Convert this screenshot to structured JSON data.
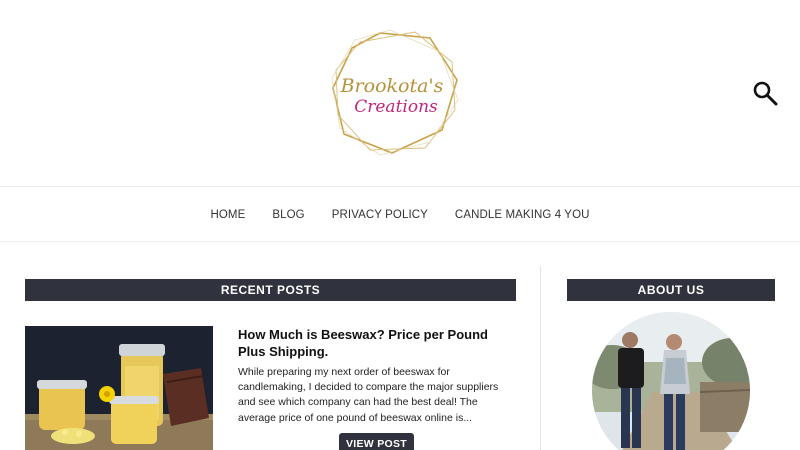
{
  "header": {
    "logo_text_line1": "Brookota's",
    "logo_text_line2": "Creations",
    "search_icon": "search-icon"
  },
  "nav": {
    "items": [
      {
        "label": "HOME"
      },
      {
        "label": "BLOG"
      },
      {
        "label": "PRIVACY POLICY"
      },
      {
        "label": "CANDLE MAKING 4 YOU"
      }
    ]
  },
  "recent_posts": {
    "heading": "RECENT POSTS",
    "posts": [
      {
        "title": "How Much is Beeswax? Price per Pound Plus Shipping.",
        "excerpt": "While preparing my next order of beeswax for candlemaking, I decided to compare the major suppliers and see which company can had the best deal! The average price of one pound of beeswax online is...",
        "button_label": "VIEW POST"
      }
    ]
  },
  "about": {
    "heading": "ABOUT US"
  },
  "colors": {
    "bar_bg": "#30323d",
    "logo_gold": "#c9a24a",
    "logo_magenta": "#c2267a"
  }
}
